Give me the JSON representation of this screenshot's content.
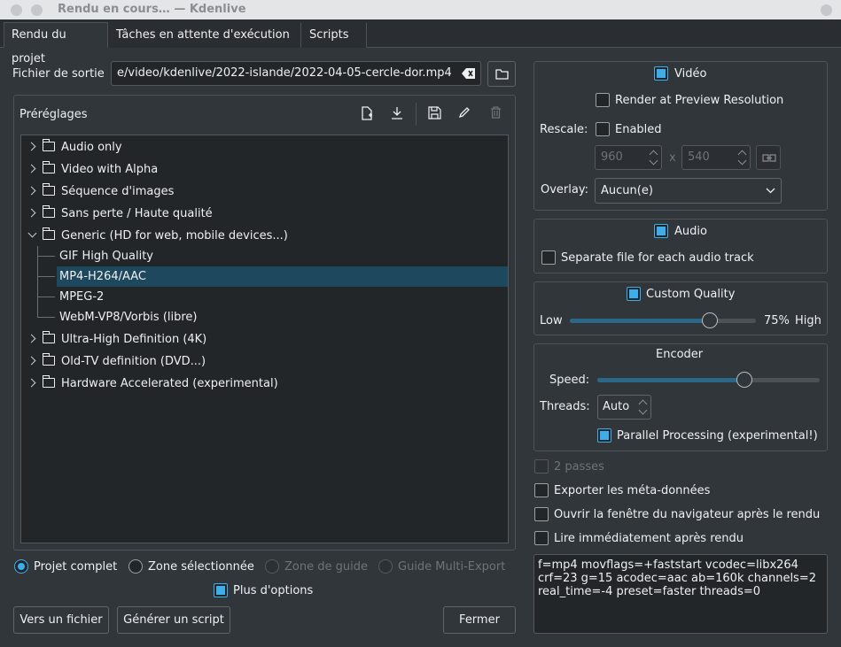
{
  "window": {
    "title": "Rendu en cours… — Kdenlive"
  },
  "tabs": [
    {
      "label": "Rendu du projet"
    },
    {
      "label": "Tâches en attente d'exécution"
    },
    {
      "label": "Scripts"
    }
  ],
  "output": {
    "label": "Fichier de sortie",
    "value": "e/video/kdenlive/2022-islande/2022-04-05-cercle-dor.mp4"
  },
  "presets": {
    "title": "Préréglages",
    "tree": [
      {
        "label": "Audio only",
        "type": "folder",
        "expanded": false
      },
      {
        "label": "Video with Alpha",
        "type": "folder",
        "expanded": false
      },
      {
        "label": "Séquence d'images",
        "type": "folder",
        "expanded": false
      },
      {
        "label": "Sans perte / Haute qualité",
        "type": "folder",
        "expanded": false
      },
      {
        "label": "Generic (HD for web, mobile devices...)",
        "type": "folder",
        "expanded": true
      },
      {
        "label": "GIF High Quality",
        "type": "item"
      },
      {
        "label": "MP4-H264/AAC",
        "type": "item",
        "selected": true
      },
      {
        "label": "MPEG-2",
        "type": "item"
      },
      {
        "label": "WebM-VP8/Vorbis (libre)",
        "type": "item"
      },
      {
        "label": "Ultra-High Definition (4K)",
        "type": "folder",
        "expanded": false
      },
      {
        "label": "Old-TV definition (DVD...)",
        "type": "folder",
        "expanded": false
      },
      {
        "label": "Hardware Accelerated (experimental)",
        "type": "folder",
        "expanded": false
      }
    ]
  },
  "range": {
    "full": "Projet complet",
    "selected_zone": "Zone sélectionnée",
    "guide_zone": "Zone de guide",
    "multi_export": "Guide Multi-Export"
  },
  "more_options": "Plus d'options",
  "buttons": {
    "to_file": "Vers un fichier",
    "script": "Générer un script",
    "close": "Fermer"
  },
  "video": {
    "label": "Vidéo",
    "preview_resolution": "Render at Preview Resolution",
    "rescale_label": "Rescale:",
    "rescale_enabled": "Enabled",
    "width": "960",
    "x": "x",
    "height": "540",
    "overlay_label": "Overlay:",
    "overlay_value": "Aucun(e)"
  },
  "audio": {
    "label": "Audio",
    "separate": "Separate file for each audio track"
  },
  "quality": {
    "label": "Custom Quality",
    "low": "Low",
    "value": "75%",
    "high": "High",
    "level": 0.75
  },
  "encoder": {
    "title": "Encoder",
    "speed_label": "Speed:",
    "speed_level": 0.66,
    "threads_label": "Threads:",
    "threads_value": "Auto",
    "parallel": "Parallel Processing (experimental!)"
  },
  "options": {
    "two_pass": "2 passes",
    "metadata": "Exporter les méta-données",
    "open_browser": "Ouvrir la fenêtre du navigateur après le rendu",
    "play_after": "Lire immédiatement après rendu"
  },
  "args": "f=mp4 movflags=+faststart vcodec=libx264\ncrf=23 g=15 acodec=aac ab=160k channels=2\nreal_time=-4 preset=faster threads=0"
}
